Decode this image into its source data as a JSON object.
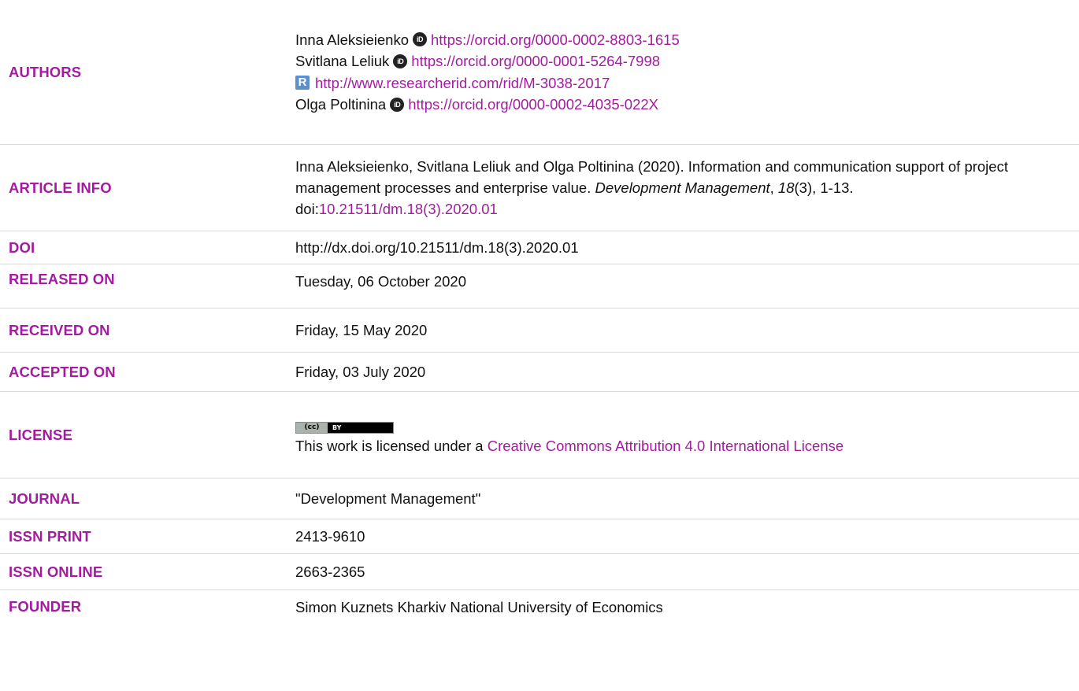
{
  "authors": {
    "label": "AUTHORS",
    "entries": [
      {
        "name": "Inna Aleksieienko",
        "orcid_url": "https://orcid.org/0000-0002-8803-1615"
      },
      {
        "name": "Svitlana Leliuk",
        "orcid_url": "https://orcid.org/0000-0001-5264-7998"
      },
      {
        "researcherid_url": "http://www.researcherid.com/rid/M-3038-2017"
      },
      {
        "name": "Olga Poltinina",
        "orcid_url": "https://orcid.org/0000-0002-4035-022X"
      }
    ],
    "orcid_icon_text": "iD",
    "researcherid_icon_text": "R"
  },
  "article_info": {
    "label": "ARTICLE INFO",
    "citation_main": "Inna Aleksieienko, Svitlana Leliuk and Olga Poltinina (2020). Information and communication support of project management processes and enterprise value.",
    "journal_italic": "Development Management",
    "comma": ",",
    "volume_italic": "18",
    "issue_pages": "(3), 1-13. doi:",
    "doi_link": "10.21511/dm.18(3).2020.01"
  },
  "doi": {
    "label": "DOI",
    "value": "http://dx.doi.org/10.21511/dm.18(3).2020.01"
  },
  "released_on": {
    "label": "RELEASED ON",
    "value": "Tuesday, 06 October 2020"
  },
  "received_on": {
    "label": "RECEIVED ON",
    "value": "Friday, 15 May 2020"
  },
  "accepted_on": {
    "label": "ACCEPTED ON",
    "value": "Friday, 03 July 2020"
  },
  "license": {
    "label": "LICENSE",
    "badge_cc": "(cc)",
    "badge_by": "BY",
    "text_prefix": "This work is licensed under a",
    "link_text": "Creative Commons Attribution 4.0 International License"
  },
  "journal": {
    "label": "JOURNAL",
    "value": "\"Development Management\""
  },
  "issn_print": {
    "label": "ISSN PRINT",
    "value": "2413-9610"
  },
  "issn_online": {
    "label": "ISSN ONLINE",
    "value": "2663-2365"
  },
  "founder": {
    "label": "FOUNDER",
    "value": "Simon Kuznets Kharkiv National University of Economics"
  },
  "colors": {
    "accent": "#a31ca0",
    "text": "#111111",
    "divider": "#d9d9d9"
  }
}
